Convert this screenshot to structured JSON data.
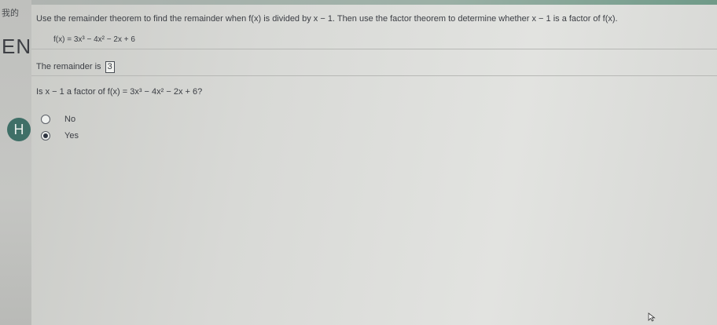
{
  "rail": {
    "label": "我的",
    "brand": "EN",
    "badge": "H"
  },
  "question": {
    "prompt": "Use the remainder theorem to find the remainder when f(x) is divided by x − 1. Then use the factor theorem to determine whether x − 1 is a factor of f(x).",
    "function": "f(x) = 3x³ − 4x² − 2x + 6",
    "remainder_label": "The remainder is",
    "remainder_value": "3",
    "factor_question": "Is x − 1 a factor of f(x) = 3x³ − 4x² − 2x + 6?",
    "options": [
      {
        "label": "No",
        "selected": false
      },
      {
        "label": "Yes",
        "selected": true
      }
    ]
  }
}
